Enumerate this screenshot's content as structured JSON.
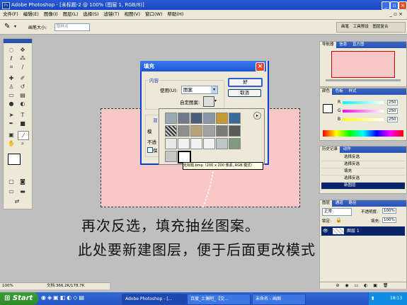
{
  "window": {
    "title": "Adobe Photoshop - [未标题-2 @ 100% (图层 1, RGB/8)]",
    "app_icon": "Ps"
  },
  "menu": {
    "items": [
      "文件(F)",
      "编辑(E)",
      "图像(I)",
      "图层(L)",
      "选择(S)",
      "滤镜(T)",
      "视图(V)",
      "窗口(W)",
      "帮助(H)"
    ],
    "doc_controls": "_ ▫ ×"
  },
  "options": {
    "brush_label": "画笔大小:",
    "brush_value": "取样点"
  },
  "right_top_tabs": [
    "画笔",
    "工具预设",
    "图层复合"
  ],
  "dialog": {
    "title": "填充",
    "content_label": "内容",
    "use_label": "使用(U):",
    "use_value": "图案",
    "custom_label": "自定图案:",
    "blend_label": "混",
    "mode_short": "模",
    "opacity_short": "不透",
    "preserve_short": "保",
    "ok": "好",
    "cancel": "取消"
  },
  "tooltip": "无标题.bmp（200 x 200 像素, RGB 模式）",
  "panels": {
    "navigator_tabs": [
      "导航器",
      "信息",
      "直方图"
    ],
    "color_tabs": [
      "颜色",
      "色板",
      "样式"
    ],
    "color_values": {
      "r": "250",
      "g": "250",
      "b": "250"
    },
    "color_labels": {
      "r": "R",
      "g": "G",
      "b": "B"
    },
    "history_tabs": [
      "历史记录",
      "动作"
    ],
    "history_items": [
      "选择反选",
      "选择反选",
      "填充",
      "选择反选",
      "新图层"
    ],
    "layers_tabs": [
      "图层",
      "通道",
      "路径"
    ],
    "blend_mode": "正常",
    "opacity_label": "不透明度:",
    "opacity_value": "100%",
    "lock_label": "锁定:",
    "fill_label": "填充:",
    "fill_value": "100%",
    "layers": [
      "图层 1"
    ]
  },
  "status": {
    "zoom": "100%",
    "doc": "文档:366.2K/178.7K"
  },
  "caption": {
    "line1": "再次反选，填充抽丝图案。",
    "line2": "此处要新建图层，便于后面更改模式"
  },
  "taskbar": {
    "start": "Start",
    "tasks": [
      "Adobe Photoshop - [...",
      "百度_土偶吧_【交...",
      "未命名 - 画图"
    ],
    "clock": "18:13"
  },
  "colors": {
    "accent": "#1c55d9",
    "canvas": "#f8c8c8",
    "taskbar": "#2456c4"
  }
}
